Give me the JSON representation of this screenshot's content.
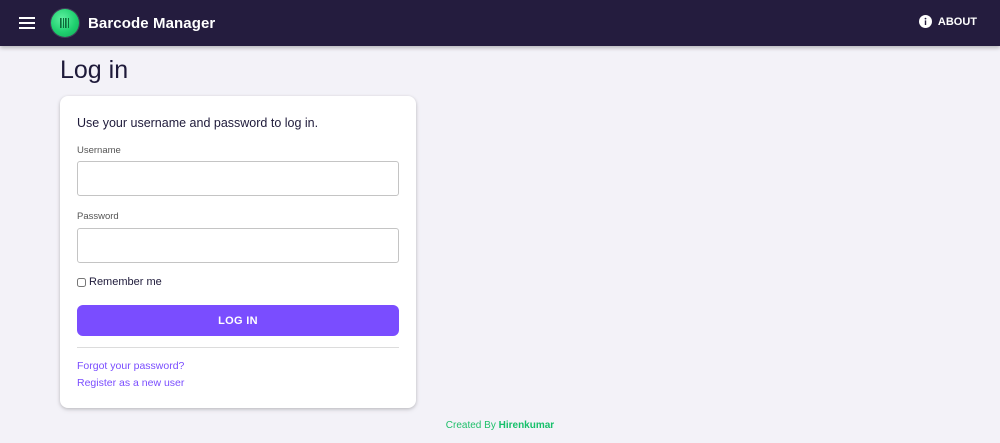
{
  "appbar": {
    "title": "Barcode Manager",
    "menu_icon": "hamburger-menu-icon",
    "logo_icon": "barcode-logo-icon",
    "about_label": "ABOUT",
    "about_icon": "info-icon",
    "background": "#241c3e"
  },
  "page": {
    "title": "Log in"
  },
  "login_form": {
    "intro": "Use your username and password to log in.",
    "username_label": "Username",
    "username_value": "",
    "password_label": "Password",
    "password_value": "",
    "remember_label": "Remember me",
    "remember_checked": false,
    "submit_label": "LOG IN",
    "accent_color": "#7a4dff"
  },
  "links": {
    "forgot_password": "Forgot your password?",
    "register": "Register as a new user"
  },
  "footer": {
    "prefix": "Created By",
    "author": "Hirenkumar",
    "color": "#16c06a"
  }
}
